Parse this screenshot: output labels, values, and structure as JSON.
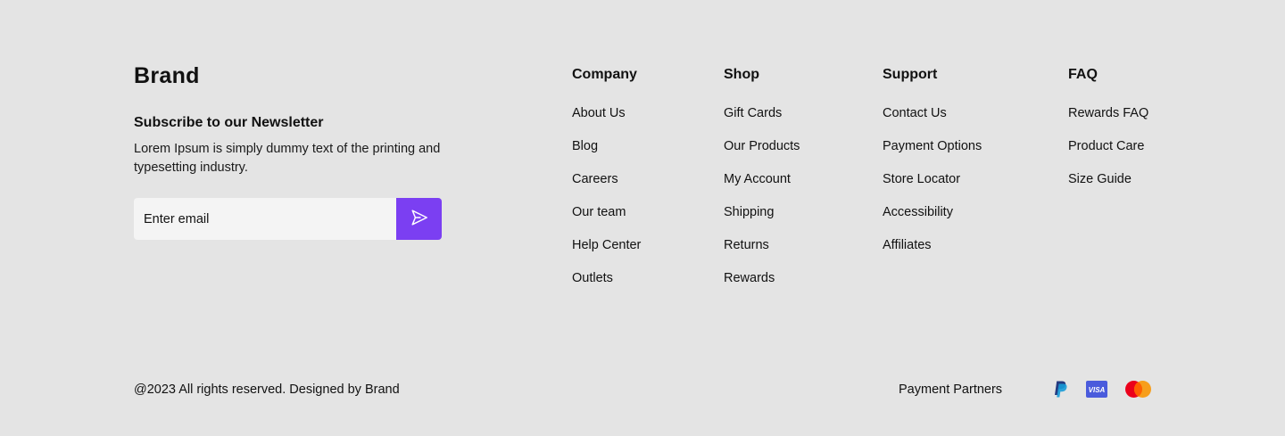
{
  "colors": {
    "background": "#e4e4e4",
    "accent": "#7b3ff2",
    "input_bg": "#f4f4f4"
  },
  "brand": "Brand",
  "newsletter": {
    "title": "Subscribe to our Newsletter",
    "description": "Lorem Ipsum is simply dummy text of the printing and typesetting industry.",
    "placeholder": "Enter email",
    "submit_icon": "send-icon"
  },
  "columns": [
    {
      "title": "Company",
      "links": [
        "About Us",
        "Blog",
        "Careers",
        "Our team",
        "Help Center",
        "Outlets"
      ]
    },
    {
      "title": "Shop",
      "links": [
        "Gift Cards",
        "Our Products",
        "My Account",
        "Shipping",
        "Returns",
        "Rewards"
      ]
    },
    {
      "title": "Support",
      "links": [
        "Contact Us",
        "Payment Options",
        "Store Locator",
        "Accessibility",
        "Affiliates"
      ]
    },
    {
      "title": "FAQ",
      "links": [
        "Rewards FAQ",
        "Product Care",
        "Size Guide"
      ]
    }
  ],
  "bottom": {
    "copyright": "@2023 All rights reserved. Designed by Brand",
    "partners_label": "Payment Partners",
    "partners": [
      "paypal-icon",
      "visa-icon",
      "mastercard-icon"
    ],
    "visa_text": "VISA"
  }
}
